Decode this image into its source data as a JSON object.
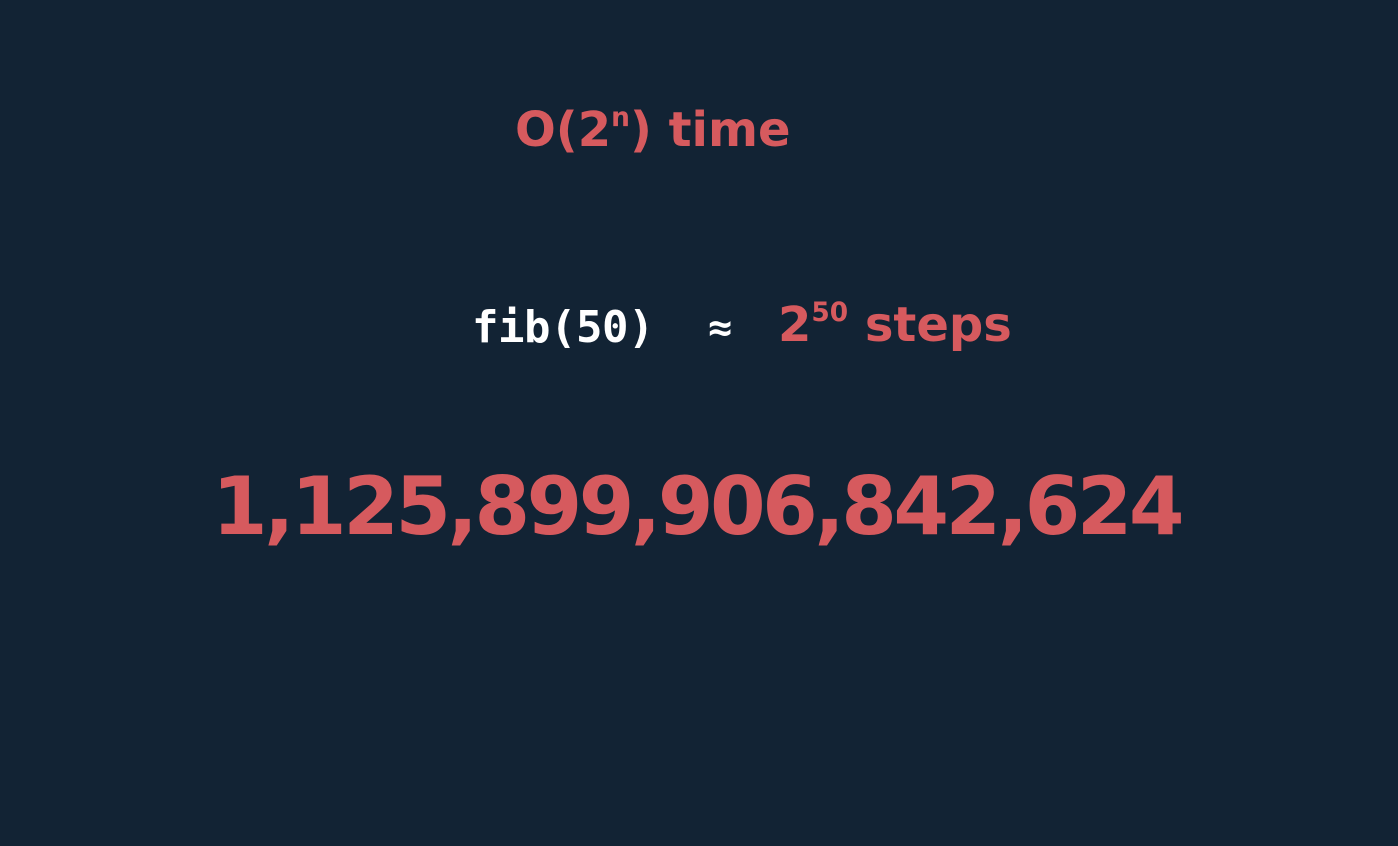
{
  "colors": {
    "background": "#122334",
    "accent": "#d65a5e",
    "code_text": "#ffffff"
  },
  "complexity": {
    "prefix": "O(2",
    "exponent": "n",
    "suffix": ") time"
  },
  "example": {
    "code": "fib(50)",
    "approx_symbol": "≈",
    "base": "2",
    "exponent": "50",
    "unit": "steps"
  },
  "result": {
    "value": "1,125,899,906,842,624"
  }
}
